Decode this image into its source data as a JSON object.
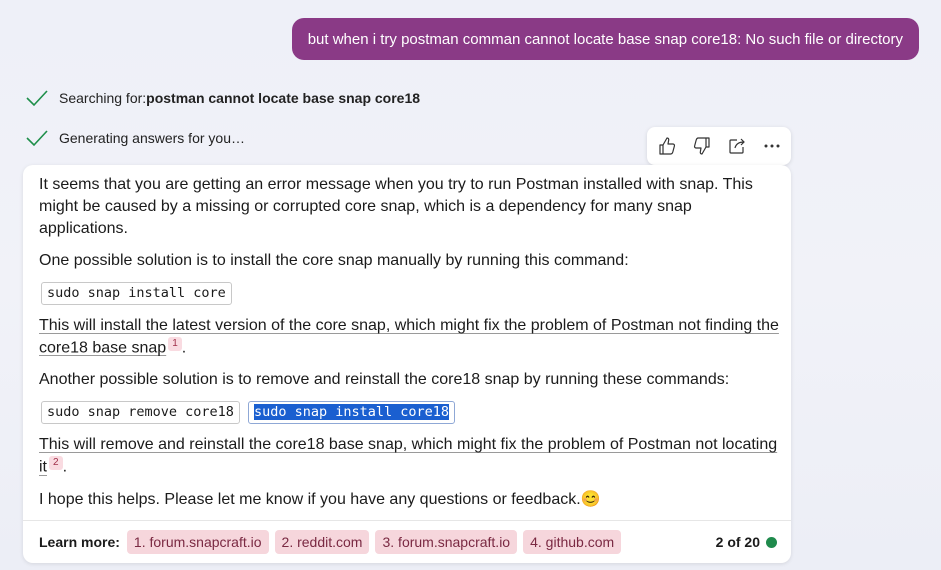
{
  "user_message": "but when i try postman comman cannot locate base snap core18: No such file or directory",
  "status": {
    "searching_prefix": "Searching for: ",
    "searching_query": "postman cannot locate base snap core18",
    "generating": "Generating answers for you…"
  },
  "actions": [
    "thumbs-up",
    "thumbs-down",
    "share",
    "more"
  ],
  "answer": {
    "p1": "It seems that you are getting an error message when you try to run Postman installed with snap. This might be caused by a missing or corrupted core snap, which is a dependency for many snap applications.",
    "p2": "One possible solution is to install the core snap manually by running this command:",
    "code1": "sudo snap install core",
    "p3": "This will install the latest version of the core snap, which might fix the problem of Postman not finding the core18 base snap",
    "p3_ref": "1",
    "p4": "Another possible solution is to remove and reinstall the core18 snap by running these commands:",
    "code2": "sudo snap remove core18",
    "code3": "sudo snap install core18",
    "p5": "This will remove and reinstall the core18 base snap, which might fix the problem of Postman not locating it",
    "p5_ref": "2",
    "p6": "I hope this helps. Please let me know if you have any questions or feedback.😊",
    "period": "."
  },
  "footer": {
    "learn_more": "Learn more:",
    "links": [
      "1. forum.snapcraft.io",
      "2. reddit.com",
      "3. forum.snapcraft.io",
      "4. github.com"
    ],
    "count": "2 of 20"
  }
}
